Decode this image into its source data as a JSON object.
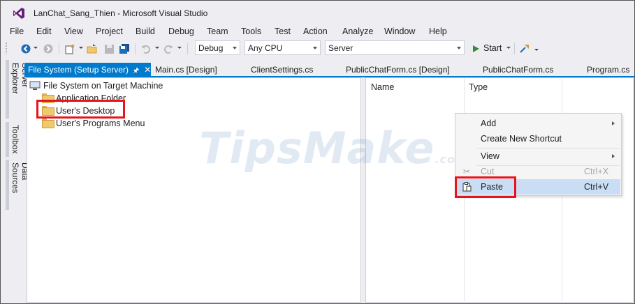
{
  "window": {
    "title": "LanChat_Sang_Thien - Microsoft Visual Studio"
  },
  "menu": [
    "File",
    "Edit",
    "View",
    "Project",
    "Build",
    "Debug",
    "Team",
    "Tools",
    "Test",
    "Action",
    "Analyze",
    "Window",
    "Help"
  ],
  "toolbar": {
    "configuration": "Debug",
    "platform": "Any CPU",
    "project": "Server",
    "start_label": "Start"
  },
  "side_tabs": [
    "Server Explorer",
    "Toolbox",
    "Data Sources"
  ],
  "tabs": [
    {
      "label": "File System (Setup Server)",
      "active": true
    },
    {
      "label": "Main.cs [Design]",
      "active": false
    },
    {
      "label": "ClientSettings.cs",
      "active": false
    },
    {
      "label": "PublicChatForm.cs [Design]",
      "active": false
    },
    {
      "label": "PublicChatForm.cs",
      "active": false
    },
    {
      "label": "Program.cs",
      "active": false
    }
  ],
  "file_system": {
    "root": "File System on Target Machine",
    "items": [
      "Application Folder",
      "User's Desktop",
      "User's Programs Menu"
    ]
  },
  "columns": [
    "Name",
    "Type"
  ],
  "context_menu": {
    "items": [
      {
        "label": "Add",
        "shortcut": "",
        "submenu": true,
        "enabled": true
      },
      {
        "label": "Create New Shortcut",
        "shortcut": "",
        "submenu": false,
        "enabled": true
      },
      {
        "label": "View",
        "shortcut": "",
        "submenu": true,
        "enabled": true
      },
      {
        "label": "Cut",
        "shortcut": "Ctrl+X",
        "submenu": false,
        "enabled": false
      },
      {
        "label": "Paste",
        "shortcut": "Ctrl+V",
        "submenu": false,
        "enabled": true
      }
    ]
  },
  "watermark": {
    "text": "TipsMake",
    "suffix": ".com"
  },
  "colors": {
    "accent": "#007acc",
    "highlight_box": "#e8141c",
    "menu_selected": "#c9def5"
  }
}
